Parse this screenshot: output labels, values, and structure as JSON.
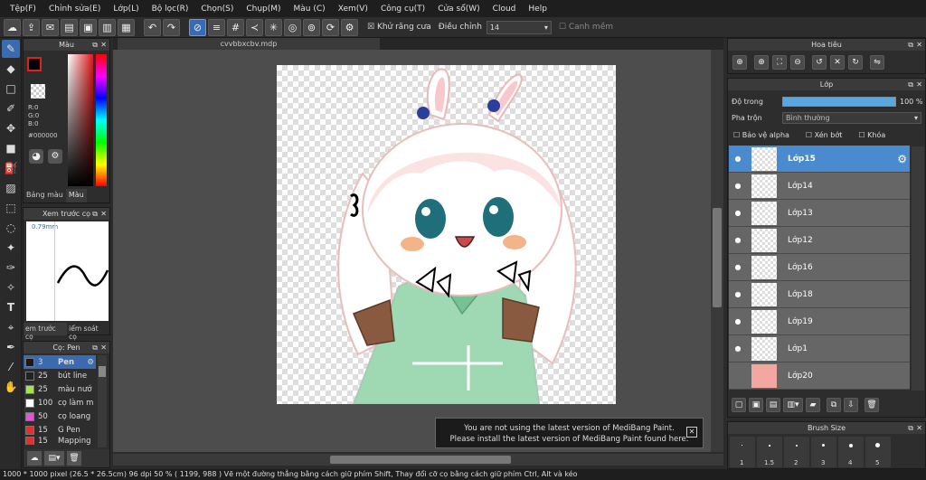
{
  "menu": [
    "Tệp(F)",
    "Chỉnh sửa(E)",
    "Lớp(L)",
    "Bộ lọc(R)",
    "Chọn(S)",
    "Chụp(M)",
    "Màu (C)",
    "Xem(V)",
    "Công cụ(T)",
    "Cửa sổ(W)",
    "Cloud",
    "Help"
  ],
  "toolbar": {
    "antialias_label": "Khử răng cưa",
    "adjust_label": "Điều chỉnh",
    "adjust_value": "14",
    "smooth_label": "Canh mềm"
  },
  "color_panel": {
    "title": "Màu",
    "r": "R:0",
    "g": "G:0",
    "b": "B:0",
    "hex": "#000000",
    "tab1": "Bảng màu",
    "tab2": "Màu"
  },
  "preview_panel": {
    "title": "Xem trước cọ",
    "size": "0.79mm",
    "tab1": "em trước cọ",
    "tab2": "iểm soát cọ"
  },
  "brush_panel": {
    "title": "Cọ: Pen",
    "items": [
      {
        "size": "3",
        "name": "Pen",
        "color": "#1a1a1a"
      },
      {
        "size": "25",
        "name": "bút line",
        "color": "#222222"
      },
      {
        "size": "25",
        "name": "màu nướ",
        "color": "#a6e34a"
      },
      {
        "size": "100",
        "name": "cọ làm m",
        "color": "#ffffff"
      },
      {
        "size": "50",
        "name": "cọ loang",
        "color": "#e055d8"
      },
      {
        "size": "15",
        "name": "G Pen",
        "color": "#e03030"
      },
      {
        "size": "15",
        "name": "Mapping",
        "color": "#e03030"
      }
    ]
  },
  "document": {
    "tab": "cvvbbxcbv.mdp"
  },
  "nav_panel": {
    "title": "Hoa tiêu"
  },
  "layer_panel": {
    "title": "Lớp",
    "opacity_label": "Độ trong",
    "opacity_value": "100 %",
    "blend_label": "Pha trộn",
    "blend_value": "Bình thường",
    "protect_alpha": "Bảo vệ alpha",
    "clipping": "Xén bớt",
    "lock": "Khóa",
    "layers": [
      "Lớp15",
      "Lớp14",
      "Lớp13",
      "Lớp12",
      "Lớp16",
      "Lớp18",
      "Lớp19",
      "Lớp1",
      "Lớp20"
    ]
  },
  "brush_size_panel": {
    "title": "Brush Size",
    "sizes": [
      "1",
      "1.5",
      "2",
      "3",
      "4",
      "5"
    ]
  },
  "notice": {
    "line1": "You are not using the latest version of MediBang Paint.",
    "line2": "Please install the latest version of MediBang Paint found here."
  },
  "status": "1000 * 1000 pixel  (26.5 * 26.5cm)  96 dpi  50 %  ( 1199, 988 )  Vẽ một đường thẳng bằng cách giữ phím Shift, Thay đổi cỡ cọ bằng cách giữ phím Ctrl, Alt và kéo",
  "colors": {
    "accent": "#3a6ab0",
    "layer_selected": "#4a8bd0",
    "fg_color": "#e02020"
  }
}
